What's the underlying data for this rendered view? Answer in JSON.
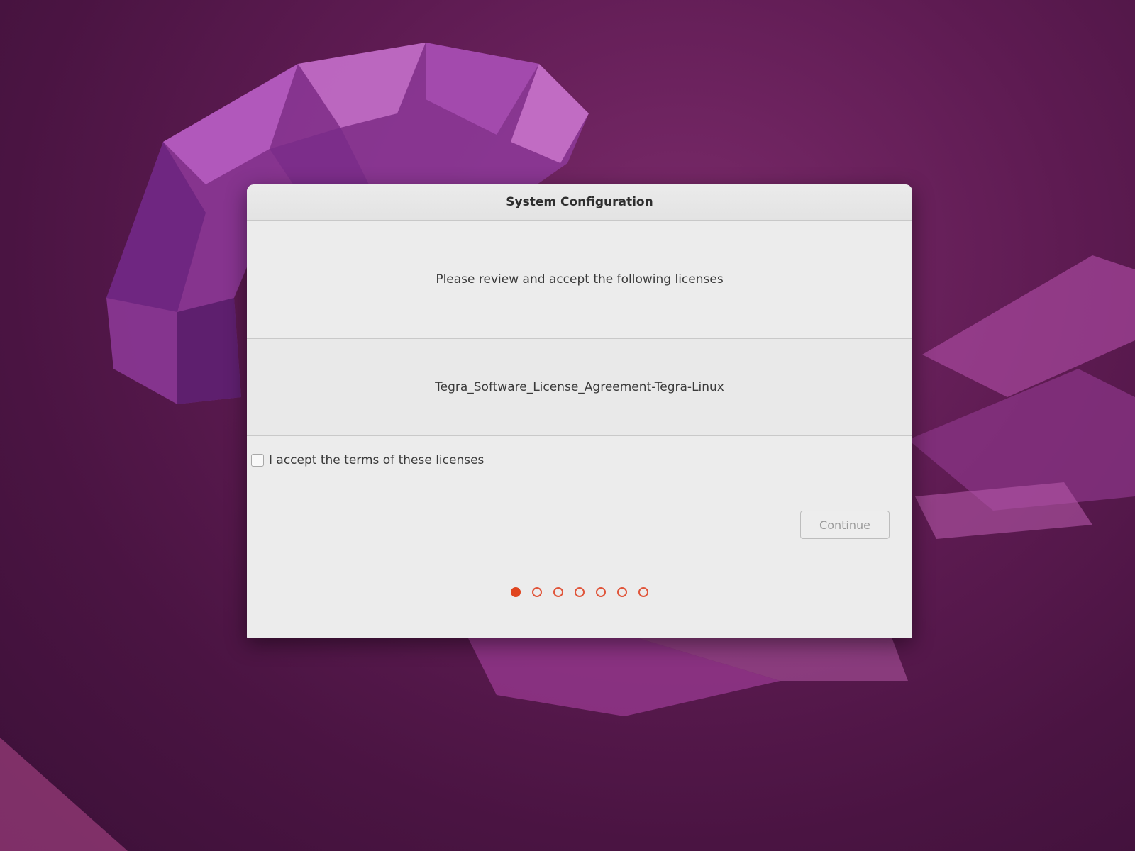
{
  "dialog": {
    "title": "System Configuration",
    "intro_text": "Please review and accept the following licenses",
    "licenses": [
      "Tegra_Software_License_Agreement-Tegra-Linux"
    ],
    "accept_label": "I accept the terms of these licenses",
    "accept_checked": false,
    "continue_label": "Continue",
    "continue_enabled": false
  },
  "pager": {
    "total_steps": 7,
    "current_step": 1
  },
  "colors": {
    "accent": "#e0451f",
    "wallpaper": "#5e1b52"
  }
}
